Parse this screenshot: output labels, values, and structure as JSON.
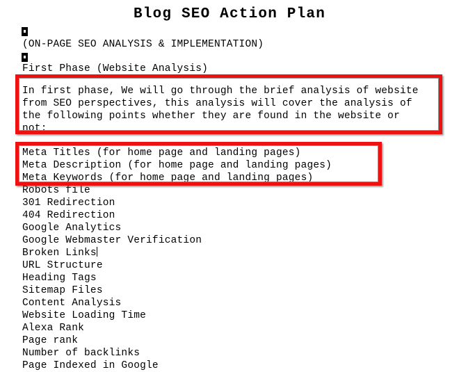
{
  "document": {
    "title": "Blog SEO Action Plan",
    "subtitle": "(ON-PAGE SEO ANALYSIS & IMPLEMENTATION)",
    "section_heading": "First Phase (Website Analysis)",
    "empty_line_glyph": "empty-paragraph-marker",
    "intro_paragraph": {
      "lines": [
        "In first phase, We will go through the brief analysis of website",
        "from SEO perspectives, this analysis will cover the analysis of",
        "the following points whether they are found in the website or",
        "not:"
      ]
    },
    "checklist": [
      "Meta Titles (for home page and landing pages)",
      "Meta Description (for home page and landing pages)",
      "Meta Keywords (for home page and landing pages)",
      "Robots file",
      "301 Redirection",
      "404 Redirection",
      "Google Analytics",
      "Google Webmaster Verification",
      "Broken Links",
      "URL Structure",
      "Heading Tags",
      "Sitemap Files",
      "Content Analysis",
      "Website Loading Time",
      "Alexa Rank",
      "Page rank",
      "Number of backlinks",
      "Page Indexed in Google"
    ],
    "cursor_after_item": "Broken Links",
    "annotations": {
      "box_color": "#ee1111",
      "box_1_label": "intro-paragraph-highlight",
      "box_2_label": "meta-tags-highlight"
    }
  }
}
